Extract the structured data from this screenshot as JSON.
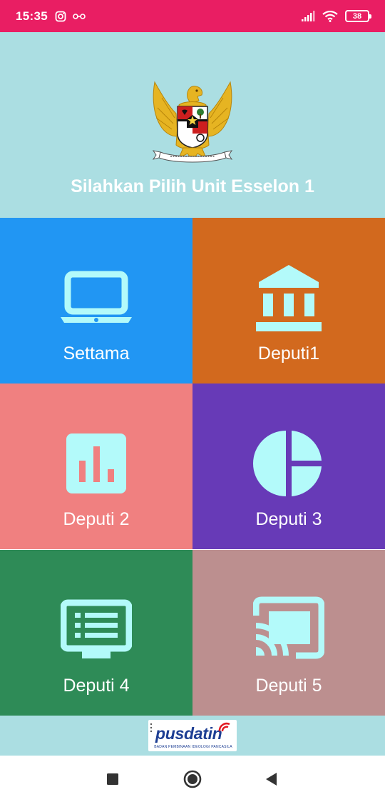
{
  "status_bar": {
    "time": "15:35",
    "battery": "38",
    "icons": [
      "instagram-icon",
      "link-icon",
      "signal-icon",
      "wifi-icon",
      "battery-icon"
    ]
  },
  "header": {
    "emblem": "garuda-pancasila-emblem",
    "emblem_motto": "BHINNEKA TUNGGAL IKA",
    "title": "Silahkan Pilih Unit Esselon 1"
  },
  "tiles": [
    {
      "label": "Settama",
      "icon": "laptop-icon",
      "color": "#2196f3"
    },
    {
      "label": "Deputi1",
      "icon": "bank-icon",
      "color": "#d2691e"
    },
    {
      "label": "Deputi 2",
      "icon": "bar-chart-icon",
      "color": "#f08080"
    },
    {
      "label": "Deputi 3",
      "icon": "pie-chart-icon",
      "color": "#673ab7"
    },
    {
      "label": "Deputi 4",
      "icon": "list-monitor-icon",
      "color": "#2e8b57"
    },
    {
      "label": "Deputi 5",
      "icon": "cast-icon",
      "color": "#bc8f8f"
    }
  ],
  "icon_color": "#b3fafa",
  "footer": {
    "logo_text": "pusdatin",
    "logo_subtext": "BADAN PEMBINAAN IDEOLOGI PANCASILA"
  },
  "nav_bar": {
    "buttons": [
      "recents-button",
      "home-button",
      "back-button"
    ]
  },
  "colors": {
    "status_bar": "#e91e63",
    "header_bg": "#abdee2"
  }
}
